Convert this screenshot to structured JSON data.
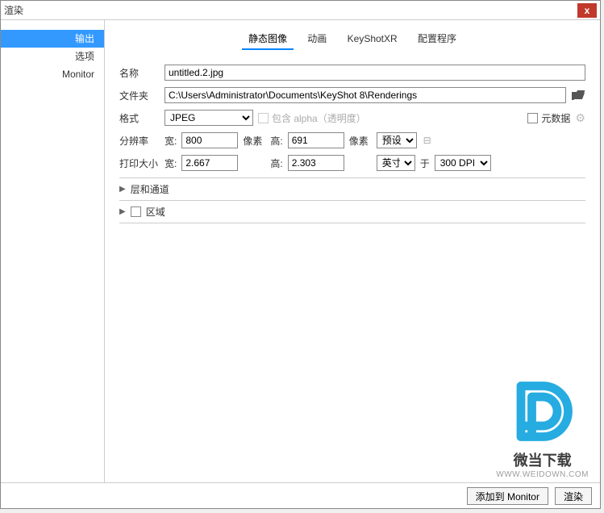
{
  "window": {
    "title": "渲染",
    "close": "x"
  },
  "sidebar": {
    "items": [
      {
        "label": "输出",
        "active": true
      },
      {
        "label": "选项",
        "active": false
      },
      {
        "label": "Monitor",
        "active": false
      }
    ]
  },
  "tabs": {
    "items": [
      {
        "label": "静态图像",
        "active": true
      },
      {
        "label": "动画",
        "active": false
      },
      {
        "label": "KeyShotXR",
        "active": false
      },
      {
        "label": "配置程序",
        "active": false
      }
    ]
  },
  "fields": {
    "name_label": "名称",
    "name_value": "untitled.2.jpg",
    "folder_label": "文件夹",
    "folder_value": "C:\\Users\\Administrator\\Documents\\KeyShot 8\\Renderings",
    "format_label": "格式",
    "format_value": "JPEG",
    "alpha_label": "包含 alpha（透明度）",
    "meta_label": "元数据",
    "res_label": "分辨率",
    "width_label": "宽:",
    "height_label": "高:",
    "res_w": "800",
    "res_h": "691",
    "pixel_unit": "像素",
    "preset_label": "预设",
    "print_label": "打印大小",
    "print_w": "2.667",
    "print_h": "2.303",
    "unit_value": "英寸",
    "at_label": "于",
    "dpi_value": "300 DPI"
  },
  "sections": {
    "layers": "层和通道",
    "region": "区域"
  },
  "footer": {
    "add": "添加到 Monitor",
    "render": "渲染"
  },
  "watermark": {
    "text": "微当下载",
    "url": "WWW.WEIDOWN.COM"
  }
}
